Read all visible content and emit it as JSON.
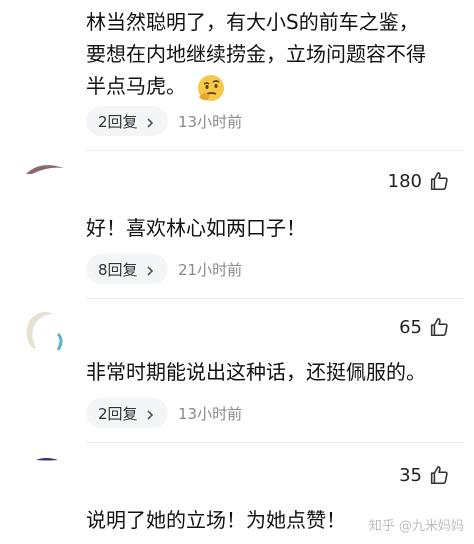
{
  "comment1": {
    "lines": [
      "林当然聪明了，有大小S的前车之鉴，",
      "要想在内地继续捞金，立场问题容不得",
      "半点马虎。"
    ],
    "emoji": "thinking-emoji",
    "reply_label": "2回复",
    "time": "13小时前"
  },
  "comment2": {
    "likes": "180",
    "text": "好！喜欢林心如两口子！",
    "reply_label": "8回复",
    "time": "21小时前"
  },
  "comment3": {
    "likes": "65",
    "text": "非常时期能说出这种话，还挺佩服的。",
    "reply_label": "2回复",
    "time": "13小时前"
  },
  "comment4": {
    "likes": "35",
    "text": "说明了她的立场！为她点赞！"
  },
  "watermark": "知乎 @九米妈妈",
  "colors": {
    "reply_bg": "#f4f5f7",
    "muted": "#8a8a8a",
    "text": "#121212"
  }
}
